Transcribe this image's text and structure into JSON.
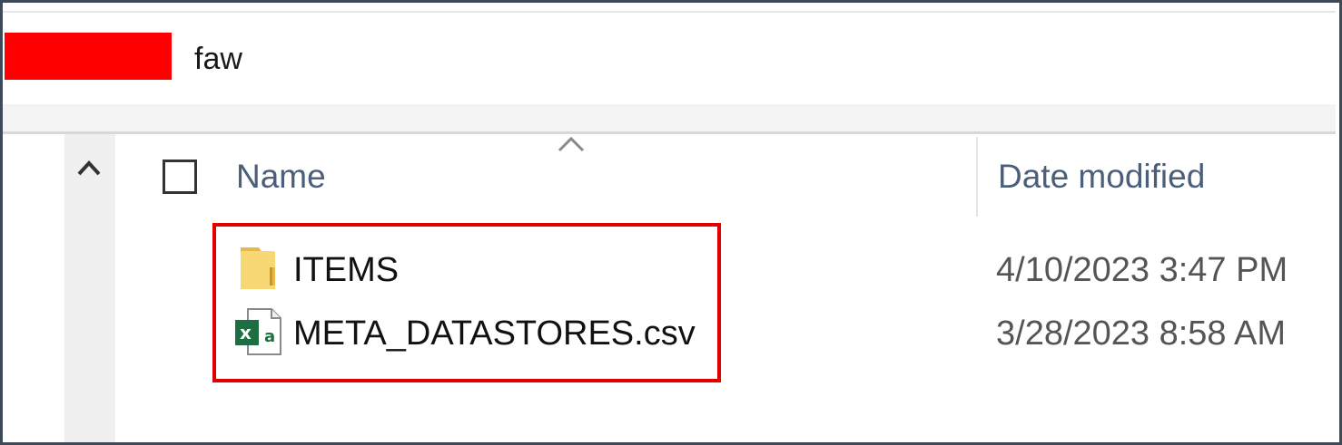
{
  "address_bar": {
    "path_text": "faw"
  },
  "columns": {
    "name": "Name",
    "date_modified": "Date modified"
  },
  "files": [
    {
      "name": "ITEMS",
      "date_modified": "4/10/2023 3:47 PM",
      "icon": "folder-icon"
    },
    {
      "name": "META_DATASTORES.csv",
      "date_modified": "3/28/2023 8:58 AM",
      "icon": "excel-csv-icon"
    }
  ],
  "colors": {
    "redaction": "#ff0000",
    "highlight_border": "#e00000",
    "header_text": "#4b5e7a",
    "folder_yellow": "#f8d775",
    "excel_green": "#1d6f42"
  }
}
